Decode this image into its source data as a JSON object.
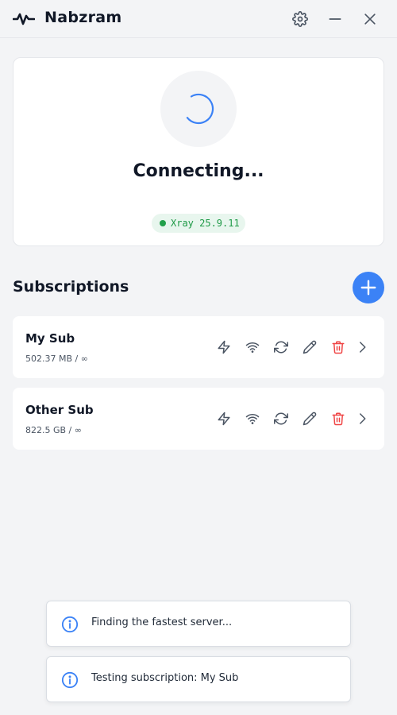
{
  "app": {
    "title": "Nabzram",
    "logo_icon": "pulse-icon",
    "controls": {
      "settings_icon": "gear-icon",
      "minimize_icon": "minimize-icon",
      "close_icon": "close-icon"
    }
  },
  "connection": {
    "status": "Connecting...",
    "core_badge": "Xray 25.9.11",
    "spinner_icon": "loading-spinner-icon"
  },
  "subscriptions": {
    "title": "Subscriptions",
    "add_icon": "plus-icon",
    "items": [
      {
        "name": "My Sub",
        "usage": "502.37 MB / ∞"
      },
      {
        "name": "Other Sub",
        "usage": "822.5 GB / ∞"
      }
    ],
    "action_icons": [
      "lightning-icon",
      "wifi-icon",
      "refresh-icon",
      "pencil-icon",
      "trash-icon",
      "chevron-right-icon"
    ]
  },
  "toasts": [
    {
      "icon": "info-icon",
      "message": "Finding the fastest server..."
    },
    {
      "icon": "info-icon",
      "message": "Testing subscription: My Sub"
    }
  ],
  "colors": {
    "accent": "#3b82f6",
    "danger": "#ef4444",
    "success": "#22a04b",
    "background": "#f3f4f6"
  }
}
